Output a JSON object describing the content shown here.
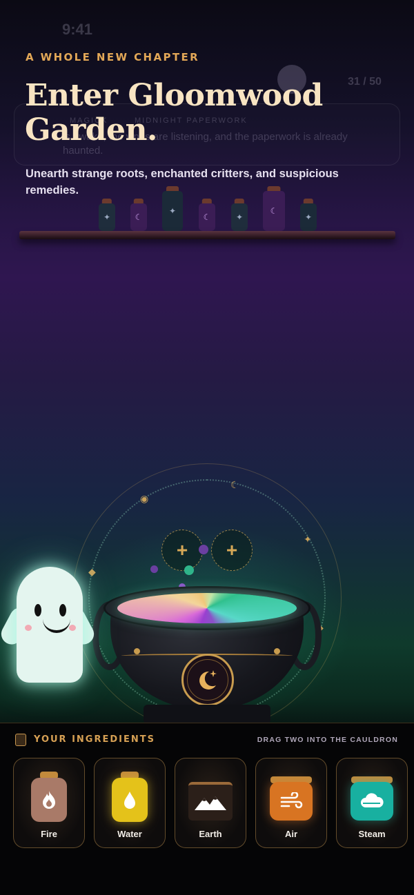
{
  "intro": {
    "eyebrow": "A WHOLE NEW CHAPTER",
    "title": "Enter Gloomwood Garden.",
    "subtitle": "Unearth strange roots, enchanted critters, and suspicious remedies."
  },
  "background_hud": {
    "time": "9:41",
    "counter": "31 / 50",
    "card_tag_left": "MAGICK",
    "card_tag_right": "MIDNIGHT PAPERWORK",
    "card_text": "is awake, the vines are listening, and the paperwork is already haunted."
  },
  "ingredients": {
    "heading": "YOUR INGREDIENTS",
    "hint": "DRAG TWO INTO THE CAULDRON",
    "items": [
      {
        "label": "Fire",
        "icon": "flame-icon",
        "color": "#b07d6a"
      },
      {
        "label": "Water",
        "icon": "droplet-icon",
        "color": "#e4c21a"
      },
      {
        "label": "Earth",
        "icon": "mountains-icon",
        "color": "#3a2a20"
      },
      {
        "label": "Air",
        "icon": "wind-icon",
        "color": "#d87422"
      },
      {
        "label": "Steam",
        "icon": "cloud-icon",
        "color": "#1ab0a0"
      }
    ]
  },
  "colors": {
    "accent_gold": "#e3a857",
    "title_cream": "#f8e4c2"
  }
}
